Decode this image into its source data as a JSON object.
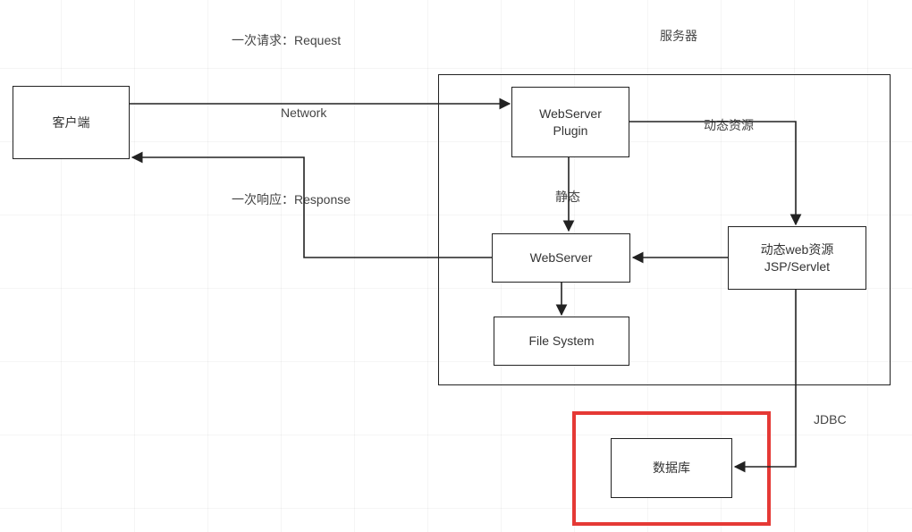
{
  "title_request": "一次请求：Request",
  "title_server": "服务器",
  "client": "客户端",
  "network": "Network",
  "response": "一次响应：Response",
  "webserver_plugin_l1": "WebServer",
  "webserver_plugin_l2": "Plugin",
  "dynamic_resource": "动态资源",
  "static_label": "静态",
  "webserver": "WebServer",
  "dynamic_web_l1": "动态web资源",
  "dynamic_web_l2": "JSP/Servlet",
  "filesystem": "File System",
  "jdbc": "JDBC",
  "database": "数据库"
}
